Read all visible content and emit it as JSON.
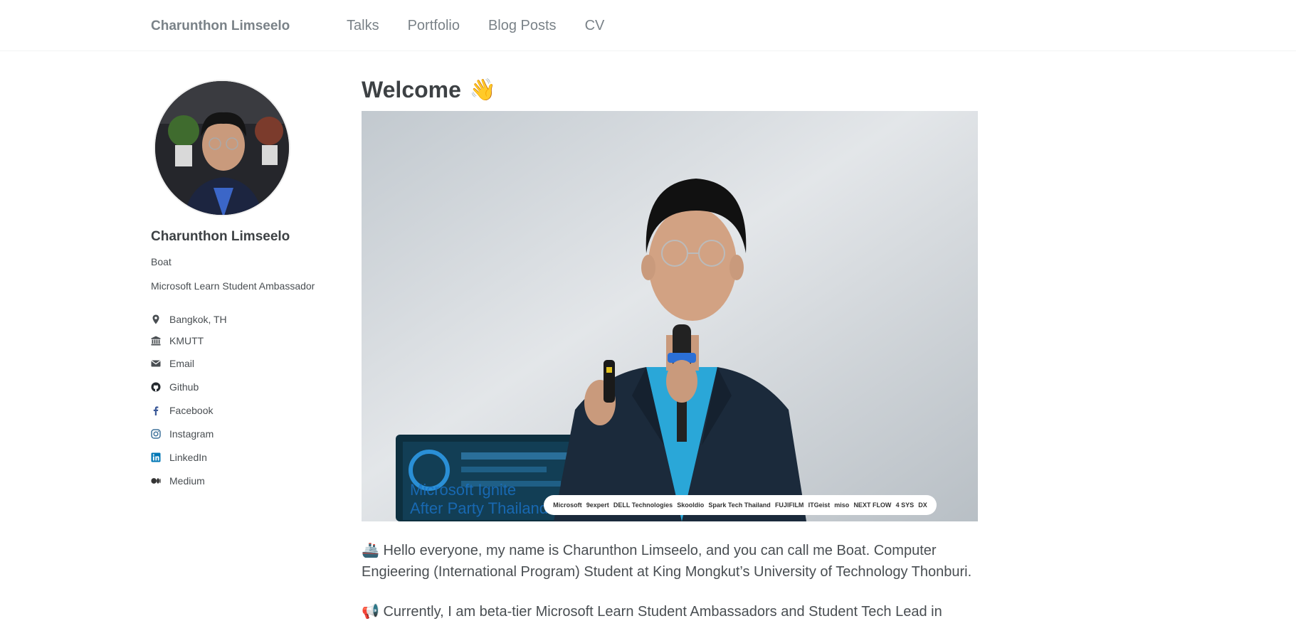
{
  "header": {
    "site_title": "Charunthon Limseelo",
    "nav": [
      "Talks",
      "Portfolio",
      "Blog Posts",
      "CV"
    ]
  },
  "sidebar": {
    "name": "Charunthon Limseelo",
    "nickname": "Boat",
    "bio": "Microsoft Learn Student Ambassador",
    "links": [
      {
        "icon": "location-icon",
        "label": "Bangkok, TH"
      },
      {
        "icon": "institution-icon",
        "label": "KMUTT"
      },
      {
        "icon": "envelope-icon",
        "label": "Email"
      },
      {
        "icon": "github-icon",
        "label": "Github"
      },
      {
        "icon": "facebook-icon",
        "label": "Facebook"
      },
      {
        "icon": "instagram-icon",
        "label": "Instagram"
      },
      {
        "icon": "linkedin-icon",
        "label": "LinkedIn"
      },
      {
        "icon": "medium-icon",
        "label": "Medium"
      }
    ]
  },
  "main": {
    "title": "Welcome",
    "title_emoji": "👋",
    "hero": {
      "event_title_line1": "Microsoft Ignite",
      "event_title_line2": "After Party Thailand",
      "sponsors": [
        "Microsoft",
        "9expert",
        "DELL Technologies",
        "Skooldio",
        "Spark Tech Thailand",
        "FUJIFILM",
        "ITGeist",
        "miso",
        "NEXT FLOW",
        "4 SYS",
        "DX"
      ]
    },
    "paragraphs": [
      {
        "emoji": "🚢",
        "text": "Hello everyone, my name is Charunthon Limseelo, and you can call me Boat. Computer Engieering (International Program) Student at King Mongkut’s University of Technology Thonburi."
      },
      {
        "emoji": "📢",
        "text": "Currently, I am beta-tier Microsoft Learn Student Ambassadors and Student Tech Lead in"
      }
    ]
  },
  "colors": {
    "text": "#494e52",
    "heading": "#3d4144",
    "nav": "#7a8288",
    "linkedin": "#0077b5",
    "instagram": "#3f729b"
  }
}
